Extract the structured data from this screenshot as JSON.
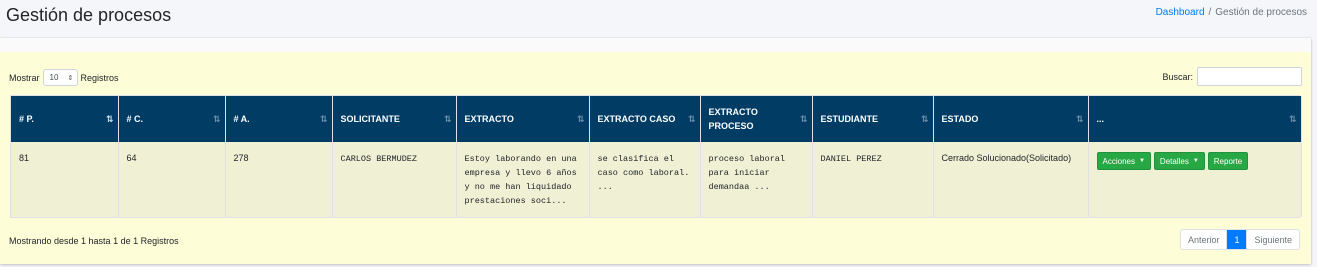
{
  "header": {
    "title": "Gestión de procesos",
    "breadcrumb": {
      "link": "Dashboard",
      "separator": "/",
      "current": "Gestión de procesos"
    }
  },
  "controls": {
    "show_label": "Mostrar",
    "show_value": "10",
    "records_label": "Registros",
    "search_label": "Buscar:",
    "search_value": ""
  },
  "table": {
    "columns": [
      "# P.",
      "# C.",
      "# A.",
      "SOLICITANTE",
      "EXTRACTO",
      "EXTRACTO CASO",
      "EXTRACTO PROCESO",
      "ESTUDIANTE",
      "ESTADO",
      "..."
    ],
    "rows": [
      {
        "p": "81",
        "c": "64",
        "a": "278",
        "solicitante": "CARLOS BERMUDEZ",
        "extracto": "Estoy laborando en una empresa y llevo 6 años y no me han liquidado prestaciones soci...",
        "extracto_caso": "se clasifica el caso como laboral. ...",
        "extracto_proceso": "proceso laboral para iniciar demandaa ...",
        "estudiante": "DANIEL PEREZ",
        "estado": "Cerrado Solucionado(Solicitado)",
        "actions": {
          "acciones": "Acciones",
          "detalles": "Detalles",
          "reporte": "Reporte"
        }
      }
    ]
  },
  "footer": {
    "info": "Mostrando desde 1 hasta 1 de 1 Registros",
    "prev": "Anterior",
    "page": "1",
    "next": "Siguiente"
  },
  "colors": {
    "header_bg": "#003c64",
    "card_bg": "#fdfdd8",
    "btn_green": "#28a745",
    "primary": "#007bff"
  }
}
